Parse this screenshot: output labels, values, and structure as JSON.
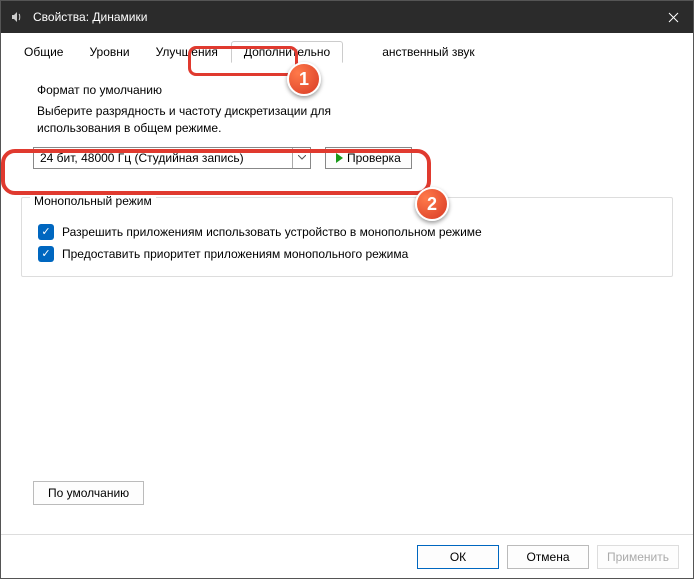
{
  "window": {
    "title": "Свойства: Динамики"
  },
  "tabs": {
    "general": "Общие",
    "levels": "Уровни",
    "enhancements": "Улучшения",
    "advanced": "Дополнительно",
    "spatial_partial": "анственный звук"
  },
  "badges": {
    "one": "1",
    "two": "2"
  },
  "group_format": {
    "title": "Формат по умолчанию",
    "desc_line1": "Выберите разрядность и частоту дискретизации для",
    "desc_line2": "использования в общем режиме.",
    "combo_value": "24 бит, 48000 Гц (Студийная запись)",
    "test_label": "Проверка"
  },
  "group_exclusive": {
    "title": "Монопольный режим",
    "chk1": "Разрешить приложениям использовать устройство в монопольном режиме",
    "chk2": "Предоставить приоритет приложениям монопольного режима"
  },
  "buttons": {
    "defaults": "По умолчанию",
    "ok": "ОК",
    "cancel": "Отмена",
    "apply": "Применить"
  }
}
